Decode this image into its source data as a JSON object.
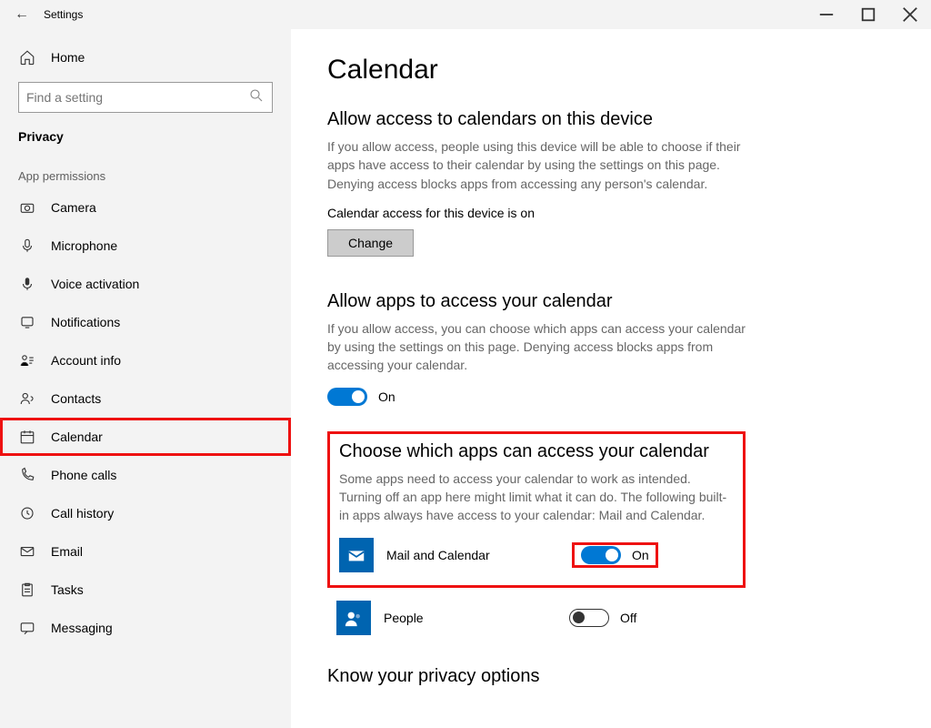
{
  "window": {
    "title": "Settings"
  },
  "sidebar": {
    "home": "Home",
    "search_placeholder": "Find a setting",
    "section": "Privacy",
    "group": "App permissions",
    "items": [
      {
        "label": "Camera"
      },
      {
        "label": "Microphone"
      },
      {
        "label": "Voice activation"
      },
      {
        "label": "Notifications"
      },
      {
        "label": "Account info"
      },
      {
        "label": "Contacts"
      },
      {
        "label": "Calendar",
        "highlighted": true
      },
      {
        "label": "Phone calls"
      },
      {
        "label": "Call history"
      },
      {
        "label": "Email"
      },
      {
        "label": "Tasks"
      },
      {
        "label": "Messaging"
      }
    ]
  },
  "page": {
    "title": "Calendar",
    "access_heading": "Allow access to calendars on this device",
    "access_desc": "If you allow access, people using this device will be able to choose if their apps have access to their calendar by using the settings on this page. Denying access blocks apps from accessing any person's calendar.",
    "access_status_line": "Calendar access for this device is on",
    "change_btn": "Change",
    "allow_apps_heading": "Allow apps to access your calendar",
    "allow_apps_desc": "If you allow access, you can choose which apps can access your calendar by using the settings on this page. Denying access blocks apps from accessing your calendar.",
    "allow_apps_toggle": {
      "state": "on",
      "label": "On"
    },
    "choose_heading": "Choose which apps can access your calendar",
    "choose_desc": "Some apps need to access your calendar to work as intended. Turning off an app here might limit what it can do. The following built-in apps always have access to your calendar: Mail and Calendar.",
    "apps": [
      {
        "name": "Mail and Calendar",
        "state": "on",
        "label": "On",
        "highlighted": true
      },
      {
        "name": "People",
        "state": "off",
        "label": "Off",
        "highlighted": false
      }
    ],
    "know_heading": "Know your privacy options"
  }
}
